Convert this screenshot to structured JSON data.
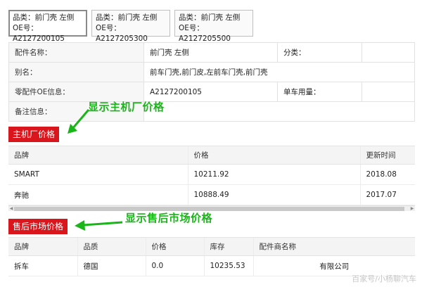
{
  "tabs": [
    {
      "line1": "品类：前门壳 左侧",
      "line2": "OE号：A2127200105",
      "active": true
    },
    {
      "line1": "品类：前门壳 左侧",
      "line2": "OE号：A2127205300",
      "active": false
    },
    {
      "line1": "品类：前门壳 左侧",
      "line2": "OE号：A2127205500",
      "active": false
    }
  ],
  "info": {
    "part_name_label": "配件名称：",
    "part_name_value": "前门壳 左侧",
    "category_label": "分类：",
    "category_value": "",
    "alias_label": "别名：",
    "alias_value": "前车门壳,前门皮,左前车门壳,前门壳",
    "oe_label": "零配件OE信息：",
    "oe_value": "A2127200105",
    "usage_label": "单车用量：",
    "usage_value": "",
    "remark_label": "备注信息：",
    "remark_value": ""
  },
  "oem_section": {
    "label": "主机厂价格",
    "annotation": "显示主机厂价格",
    "headers": [
      "品牌",
      "价格",
      "更新时间"
    ],
    "rows": [
      [
        "SMART",
        "10211.92",
        "2018.08"
      ],
      [
        "奔驰",
        "10888.49",
        "2017.07"
      ]
    ]
  },
  "aftermarket_section": {
    "label": "售后市场价格",
    "annotation": "显示售后市场价格",
    "headers": [
      "品牌",
      "品质",
      "价格",
      "库存",
      "配件商名称"
    ],
    "rows": [
      [
        "拆车",
        "德国",
        "0.0",
        "10235.53",
        "有限公司"
      ]
    ]
  },
  "watermark": "百家号/小杨聊汽车",
  "colors": {
    "section_red": "#d9161c",
    "annotation_green": "#19b519"
  }
}
